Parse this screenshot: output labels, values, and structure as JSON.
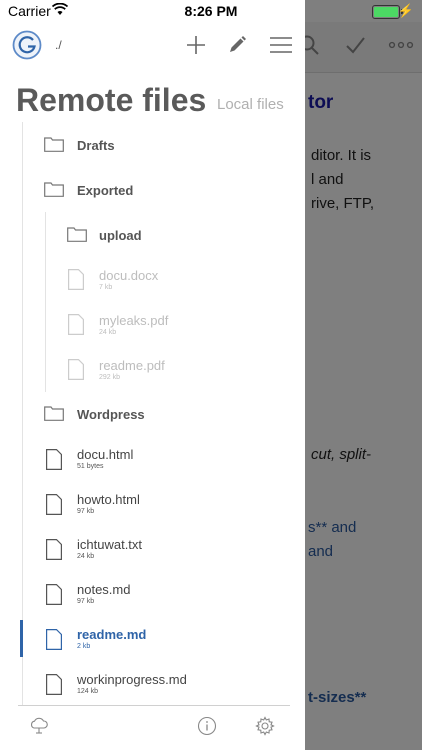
{
  "status_bar": {
    "carrier": "Carrier",
    "time": "8:26 PM"
  },
  "drawer": {
    "path": "./",
    "title": "Remote files",
    "alt_title": "Local files",
    "items": [
      {
        "name": "Drafts",
        "kind": "folder",
        "size": ""
      },
      {
        "name": "Exported",
        "kind": "folder",
        "size": ""
      },
      {
        "name": "upload",
        "kind": "folder",
        "size": ""
      },
      {
        "name": "docu.docx",
        "kind": "file",
        "size": "7 kb"
      },
      {
        "name": "myleaks.pdf",
        "kind": "file",
        "size": "24 kb"
      },
      {
        "name": "readme.pdf",
        "kind": "file",
        "size": "292 kb"
      },
      {
        "name": "Wordpress",
        "kind": "folder",
        "size": ""
      },
      {
        "name": "docu.html",
        "kind": "file",
        "size": "51 bytes"
      },
      {
        "name": "howto.html",
        "kind": "file",
        "size": "97 kb"
      },
      {
        "name": "ichtuwat.txt",
        "kind": "file",
        "size": "24 kb"
      },
      {
        "name": "notes.md",
        "kind": "file",
        "size": "97 kb"
      },
      {
        "name": "readme.md",
        "kind": "file",
        "size": "2 kb"
      },
      {
        "name": "workinprogress.md",
        "kind": "file",
        "size": "124 kb"
      }
    ]
  },
  "editor": {
    "lines": [
      "tor",
      "ditor. It is",
      "l and",
      "rive, FTP,",
      "cut, split-",
      "s** and",
      "and",
      "t-sizes**"
    ]
  },
  "colors": {
    "accent": "#2f64a8",
    "overlay": "rgba(0,0,0,0.5)",
    "battery": "#4cd964"
  }
}
